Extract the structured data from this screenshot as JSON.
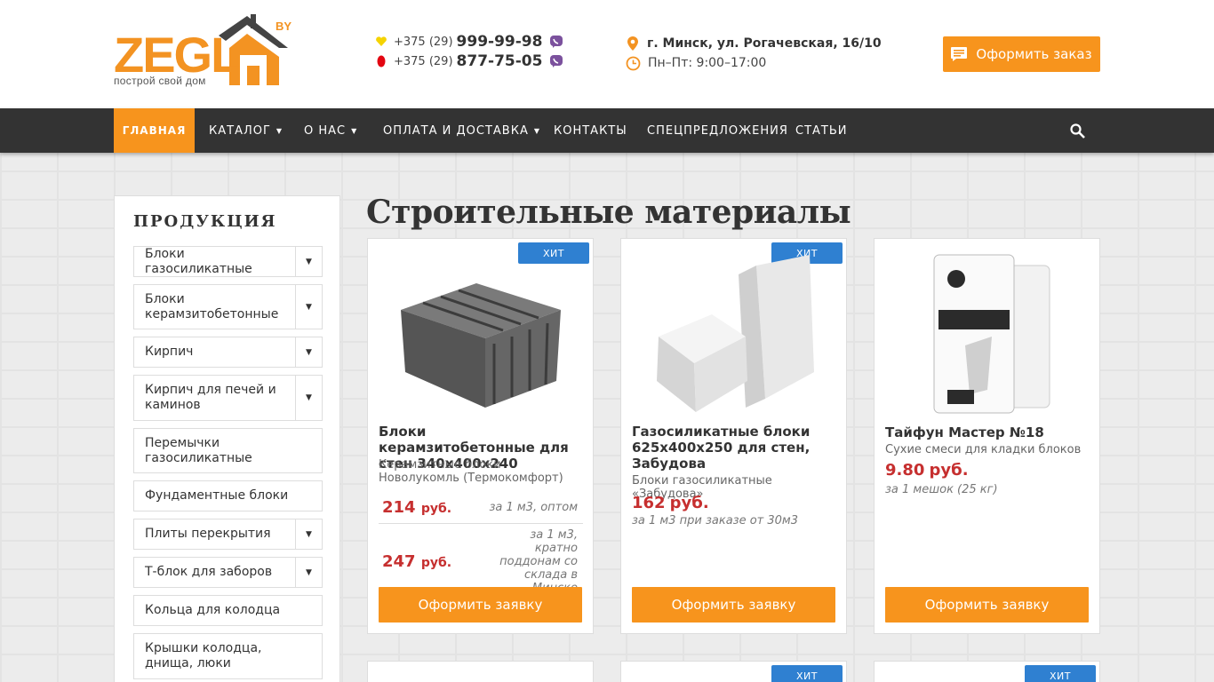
{
  "header": {
    "logo": {
      "text": "ZEGL",
      "suffix": "BY",
      "tagline": "построй свой дом"
    },
    "phones": [
      {
        "prefix": "+375 (29)",
        "number": "999-99-98",
        "operator": "velcom",
        "operator_color": "#f5d300"
      },
      {
        "prefix": "+375 (29)",
        "number": "877-75-05",
        "operator": "mts",
        "operator_color": "#e30611"
      }
    ],
    "address": "г. Минск, ул. Рогачевская, 16/10",
    "hours": "Пн–Пт: 9:00–17:00",
    "order_button": "Оформить заказ"
  },
  "nav": {
    "items": [
      {
        "label": "ГЛАВНАЯ",
        "active": true,
        "dropdown": false
      },
      {
        "label": "КАТАЛОГ",
        "active": false,
        "dropdown": true
      },
      {
        "label": "О НАС",
        "active": false,
        "dropdown": true
      },
      {
        "label": "ОПЛАТА И ДОСТАВКА",
        "active": false,
        "dropdown": true
      },
      {
        "label": "КОНТАКТЫ",
        "active": false,
        "dropdown": false
      },
      {
        "label": "СПЕЦПРЕДЛОЖЕНИЯ",
        "active": false,
        "dropdown": false
      },
      {
        "label": "СТАТЬИ",
        "active": false,
        "dropdown": false
      }
    ]
  },
  "sidebar": {
    "title": "ПРОДУКЦИЯ",
    "categories": [
      {
        "label": "Блоки газосиликатные",
        "expandable": true
      },
      {
        "label": "Блоки керамзитобетонные",
        "expandable": true
      },
      {
        "label": "Кирпич",
        "expandable": true
      },
      {
        "label": "Кирпич для печей и каминов",
        "expandable": true
      },
      {
        "label": "Перемычки газосиликатные",
        "expandable": false
      },
      {
        "label": "Фундаментные блоки",
        "expandable": false
      },
      {
        "label": "Плиты перекрытия",
        "expandable": true
      },
      {
        "label": "Т-блок для заборов",
        "expandable": true
      },
      {
        "label": "Кольца для колодца",
        "expandable": false
      },
      {
        "label": "Крышки колодца, днища, люки",
        "expandable": false
      }
    ]
  },
  "main": {
    "title": "Строительные материалы",
    "products": [
      {
        "badge": "ХИТ",
        "name": "Блоки керамзитобетонные для стен 340х400х240",
        "subtitle": "Керамзитные блоки Новолукомль (Термокомфорт)",
        "prices": [
          {
            "value": "214",
            "currency": "руб.",
            "note": "за 1 м3, оптом"
          },
          {
            "value": "247",
            "currency": "руб.",
            "note": "за 1 м3, кратно поддонам со склада в Минске"
          }
        ],
        "button": "Оформить заявку"
      },
      {
        "badge": "ХИТ",
        "name": "Газосиликатные блоки 625х400х250 для стен, Забудова",
        "subtitle": "Блоки газосиликатные «Забудова»",
        "prices": [
          {
            "value": "162",
            "currency": "руб.",
            "note": "за 1 м3 при заказе от 30м3"
          }
        ],
        "button": "Оформить заявку"
      },
      {
        "badge": "",
        "name": "Тайфун Мастер №18",
        "subtitle": "Сухие смеси для кладки блоков",
        "prices": [
          {
            "value": "9.80",
            "currency": "руб.",
            "note": "за 1 мешок (25 кг)"
          }
        ],
        "button": "Оформить заявку"
      }
    ],
    "next_row_badges": [
      "",
      "ХИТ",
      "ХИТ"
    ]
  },
  "colors": {
    "accent": "#f7941d",
    "dark": "#333333",
    "price": "#c62f2f",
    "badge": "#2f80d1"
  }
}
